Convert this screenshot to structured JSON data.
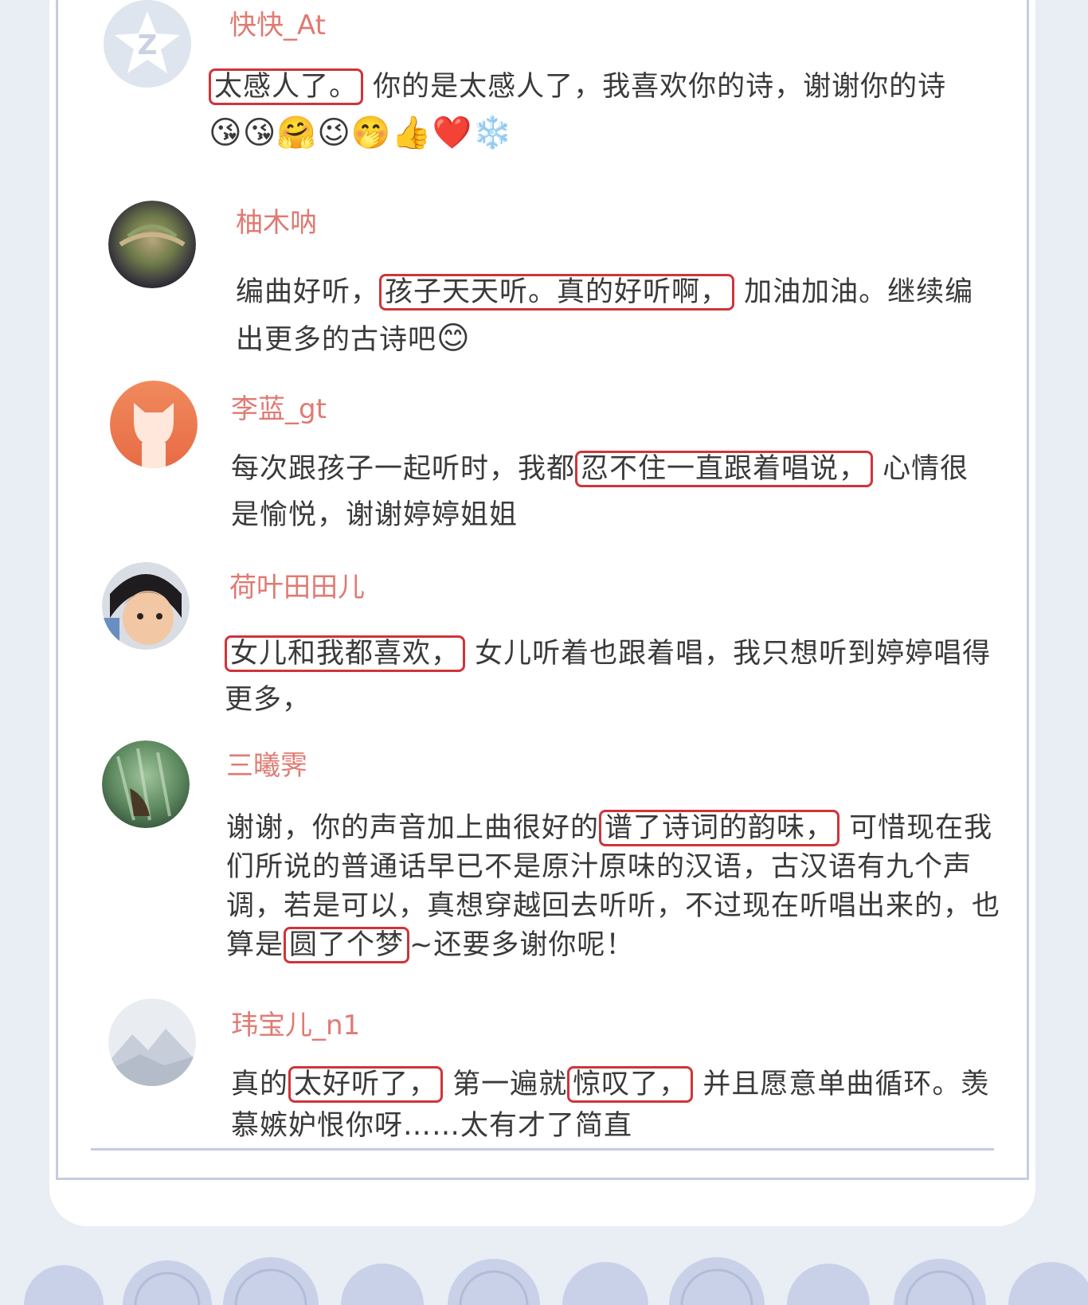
{
  "comments": [
    {
      "username": "快快_At",
      "avatar": "qq-star-avatar-icon",
      "before": "",
      "highlight1": "太感人了。",
      "middle": "你的是太感人了，我喜欢你的诗，谢谢你的诗",
      "highlight2": "",
      "after": "",
      "emoji": "😘😘🤗😉🤭👍❤️❄️"
    },
    {
      "username": "柚木呐",
      "avatar": "succulent-photo-avatar",
      "before": "编曲好听，",
      "highlight1": "孩子天天听。真的好听啊，",
      "middle": "加油加油。继续编出更多的古诗吧",
      "highlight2": "",
      "after": "",
      "emoji": "😊"
    },
    {
      "username": "李蓝_gt",
      "avatar": "orange-cat-avatar-icon",
      "before": "每次跟孩子一起听时，我都",
      "highlight1": "忍不住一直跟着唱说，",
      "middle": "心情很是愉悦，谢谢婷婷姐姐",
      "highlight2": "",
      "after": "",
      "emoji": ""
    },
    {
      "username": "荷叶田田儿",
      "avatar": "child-photo-avatar",
      "before": "",
      "highlight1": "女儿和我都喜欢，",
      "middle": "女儿听着也跟着唱，我只想听到婷婷唱得更多，",
      "highlight2": "",
      "after": "",
      "emoji": ""
    },
    {
      "username": "三曦霁",
      "avatar": "plant-photo-avatar",
      "before": "谢谢，你的声音加上曲很好的",
      "highlight1": "谱了诗词的韵味，",
      "middle": "可惜现在我们所说的普通话早已不是原汁原味的汉语，古汉语有九个声调，若是可以，真想穿越回去听听，不过现在听唱出来的，也算是",
      "highlight2": "圆了个梦",
      "after": "~还要多谢你呢！",
      "emoji": ""
    },
    {
      "username": "玮宝儿_n1",
      "avatar": "misty-mountain-avatar",
      "before": "真的",
      "highlight1": "太好听了，",
      "middle": "第一遍就",
      "highlight2": "惊叹了，",
      "after": "并且愿意单曲循环。羡慕嫉妒恨你呀……太有才了简直",
      "emoji": ""
    }
  ],
  "colors": {
    "username": "#e07a72",
    "highlight_border": "#d0343a",
    "frame": "#c5cde0",
    "page_bg": "#e9edf4"
  }
}
